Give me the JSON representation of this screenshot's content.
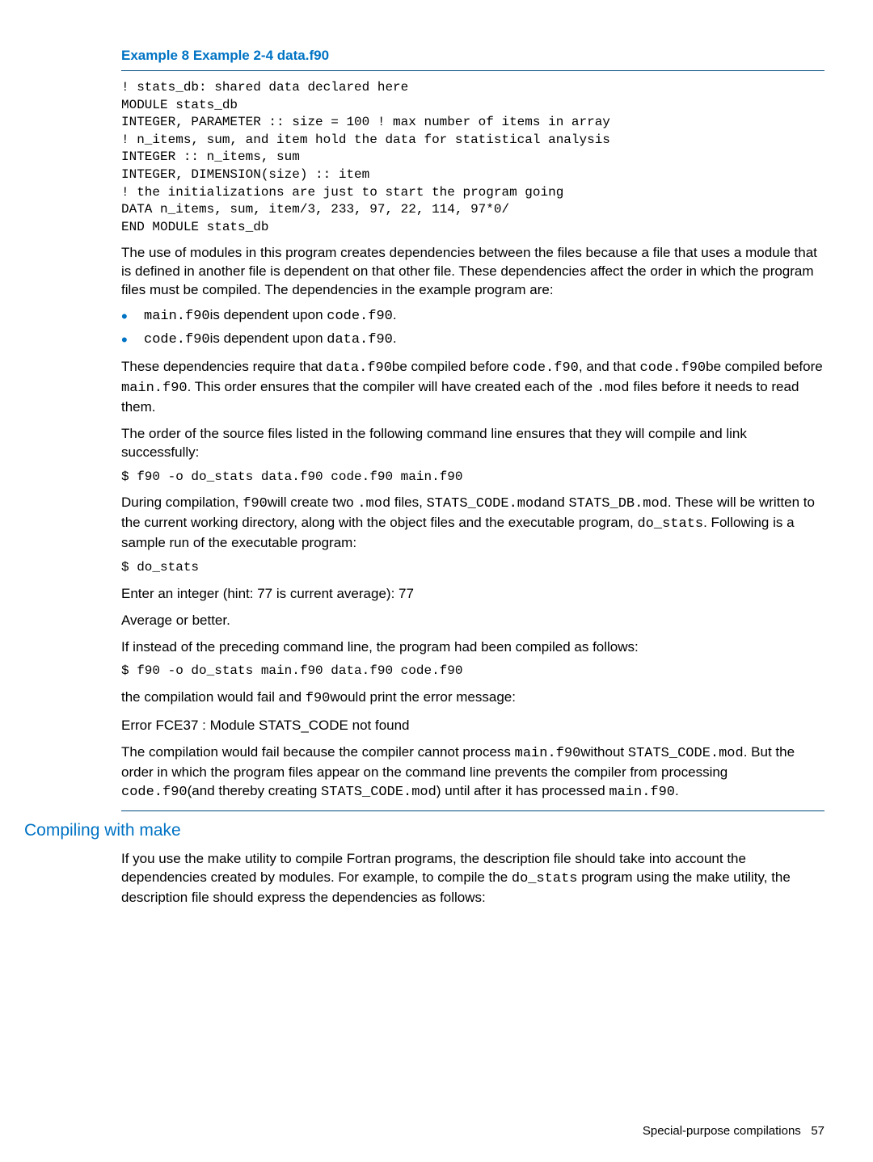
{
  "example_title": "Example 8 Example 2-4 data.f90",
  "code_block_1": "! stats_db: shared data declared here\nMODULE stats_db\nINTEGER, PARAMETER :: size = 100 ! max number of items in array\n! n_items, sum, and item hold the data for statistical analysis\nINTEGER :: n_items, sum\nINTEGER, DIMENSION(size) :: item\n! the initializations are just to start the program going\nDATA n_items, sum, item/3, 233, 97, 22, 114, 97*0/\nEND MODULE stats_db",
  "para1": "The use of modules in this program creates dependencies between the files because a file that uses a module that is defined in another file is dependent on that other file. These dependencies affect the order in which the program files must be compiled. The dependencies in the example program are:",
  "bullet1": {
    "a": "main.f90",
    "b": "is dependent upon ",
    "c": "code.f90",
    "d": "."
  },
  "bullet2": {
    "a": "code.f90",
    "b": "is dependent upon ",
    "c": "data.f90",
    "d": "."
  },
  "para2": {
    "t1": "These dependencies require that ",
    "c1": "data.f90",
    "t2": "be compiled before ",
    "c2": "code.f90",
    "t3": ", and that ",
    "c3": "code.f90",
    "t4": "be compiled before ",
    "c4": "main.f90",
    "t5": ". This order ensures that the compiler will have created each of the ",
    "c5": ".mod",
    "t6": " files before it needs to read them."
  },
  "para3": "The order of the source files listed in the following command line ensures that they will compile and link successfully:",
  "cmd1": "$ f90 -o do_stats data.f90 code.f90 main.f90",
  "para4": {
    "t1": "During compilation, ",
    "c1": "f90",
    "t2": "will create two ",
    "c2": ".mod",
    "t3": " files, ",
    "c3": "STATS_CODE.mod",
    "t4": "and ",
    "c4": "STATS_DB.mod",
    "t5": ". These will be written to the current working directory, along with the object files and the executable program, ",
    "c5": "do_stats",
    "t6": ". Following is a sample run of the executable program:"
  },
  "cmd2": "$ do_stats",
  "para5": "Enter an integer (hint: 77 is current average): 77",
  "para6": "Average or better.",
  "para7": "If instead of the preceding command line, the program had been compiled as follows:",
  "cmd3": "$ f90 -o do_stats main.f90 data.f90 code.f90",
  "para8": {
    "t1": "the compilation would fail and ",
    "c1": "f90",
    "t2": "would print the error message:"
  },
  "para9": "Error FCE37 : Module STATS_CODE not found",
  "para10": {
    "t1": "The compilation would fail because the compiler cannot process ",
    "c1": "main.f90",
    "t2": "without ",
    "c2": "STATS_CODE.mod",
    "t3": ". But the order in which the program files appear on the command line prevents the compiler from processing ",
    "c3": "code.f90",
    "t4": "(and thereby creating ",
    "c4": "STATS_CODE.mod",
    "t5": ") until after it has processed ",
    "c5": "main.f90",
    "t6": "."
  },
  "section_title": "Compiling with make",
  "para11": {
    "t1": "If you use the make utility to compile Fortran programs, the description file should take into account the dependencies created by modules. For example, to compile the ",
    "c1": "do_stats",
    "t2": " program using the make utility, the description file should express the dependencies as follows:"
  },
  "footer": {
    "label": "Special-purpose compilations",
    "page": "57"
  }
}
